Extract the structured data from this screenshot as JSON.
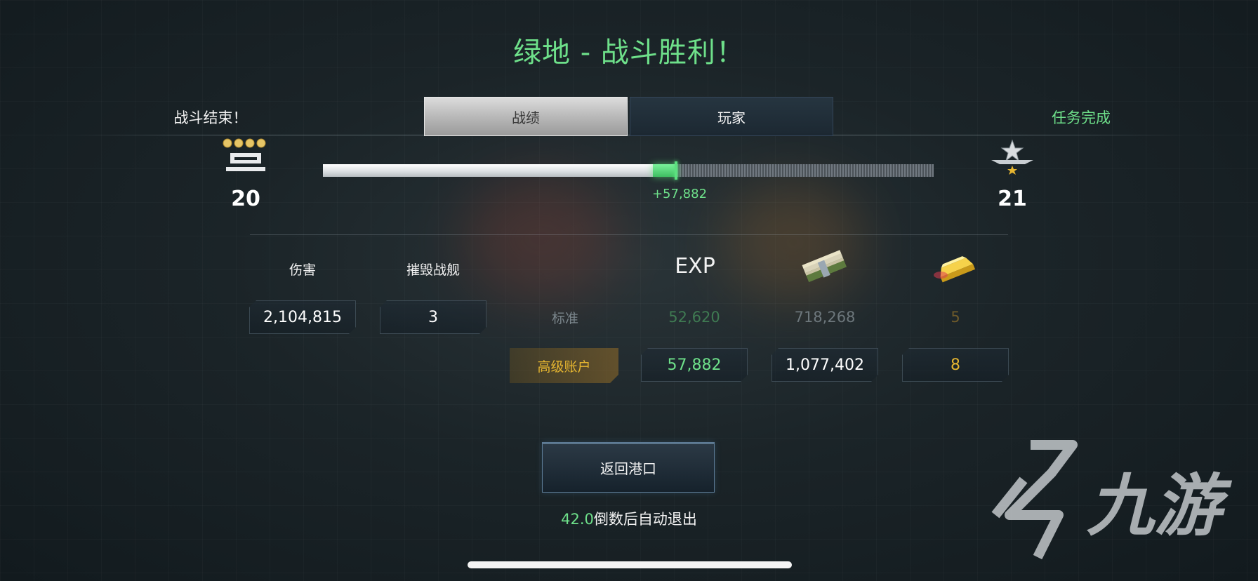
{
  "header": {
    "title": "绿地 - 战斗胜利！",
    "left_label": "战斗结束！",
    "right_label": "任务完成"
  },
  "tabs": [
    {
      "label": "战绩",
      "active": true
    },
    {
      "label": "玩家",
      "active": false
    }
  ],
  "progress": {
    "level_current": "20",
    "level_next": "21",
    "base_fraction": 0.54,
    "gain_fraction": 0.038,
    "gain_text": "+57,882"
  },
  "stats": {
    "headers": {
      "damage": "伤害",
      "destroyed": "摧毁战舰",
      "exp": "EXP"
    },
    "damage_value": "2,104,815",
    "destroyed_value": "3",
    "standard_row": {
      "label": "标准",
      "exp": "52,620",
      "credits": "718,268",
      "gold": "5"
    },
    "premium_row": {
      "label": "高级账户",
      "exp": "57,882",
      "credits": "1,077,402",
      "gold": "8"
    }
  },
  "footer": {
    "return_button": "返回港口",
    "countdown_value": "42.0",
    "countdown_text": "倒数后自动退出"
  },
  "watermark": {
    "text": "九游"
  },
  "colors": {
    "accent_green": "#6ee08a",
    "gold": "#e6b630",
    "premium_bg": "#8a6a28"
  },
  "icons": {
    "rank_left": "rank-insignia-icon",
    "rank_right": "star-rank-icon",
    "credits": "cash-stack-icon",
    "gold": "gold-bar-icon"
  }
}
